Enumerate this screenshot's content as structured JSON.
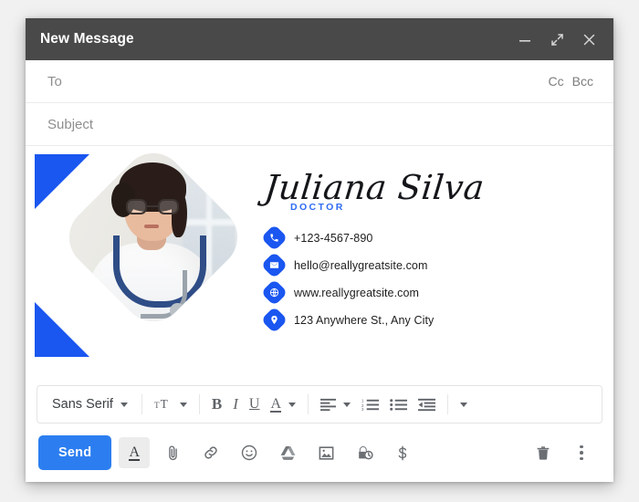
{
  "window": {
    "title": "New Message",
    "controls": [
      {
        "name": "minimize",
        "glyph": "minimize-icon"
      },
      {
        "name": "expand",
        "glyph": "expand-icon"
      },
      {
        "name": "close",
        "glyph": "close-icon"
      }
    ]
  },
  "fields": {
    "to_label": "To",
    "cc_label": "Cc",
    "bcc_label": "Bcc",
    "subject_label": "Subject",
    "to_value": "",
    "subject_value": ""
  },
  "signature": {
    "name": "Juliana Silva",
    "role": "DOCTOR",
    "accent_color": "#1a56f0",
    "role_color": "#2f6bf2",
    "contacts": [
      {
        "icon": "phone-icon",
        "text": "+123-4567-890"
      },
      {
        "icon": "envelope-icon",
        "text": "hello@reallygreatsite.com"
      },
      {
        "icon": "globe-icon",
        "text": "www.reallygreatsite.com"
      },
      {
        "icon": "location-pin-icon",
        "text": "123 Anywhere St., Any City"
      }
    ],
    "photo_alt": "doctor-portrait"
  },
  "format_toolbar": {
    "font_name": "Sans Serif",
    "items": [
      {
        "name": "font-size",
        "label": "TT"
      },
      {
        "name": "bold",
        "label": "B"
      },
      {
        "name": "italic",
        "label": "I"
      },
      {
        "name": "underline",
        "label": "U"
      },
      {
        "name": "text-color",
        "label": "A"
      },
      {
        "name": "align",
        "label": "align"
      },
      {
        "name": "numbered-list",
        "label": "1."
      },
      {
        "name": "bulleted-list",
        "label": "•"
      },
      {
        "name": "indent-less",
        "label": "indent"
      },
      {
        "name": "more-format",
        "label": "more"
      }
    ]
  },
  "action_bar": {
    "send_label": "Send",
    "send_color": "#2c7ef0",
    "icons": [
      {
        "name": "formatting-options-icon",
        "label": "A"
      },
      {
        "name": "attach-file-icon",
        "label": "attach"
      },
      {
        "name": "insert-link-icon",
        "label": "link"
      },
      {
        "name": "insert-emoji-icon",
        "label": "emoji"
      },
      {
        "name": "insert-drive-icon",
        "label": "drive"
      },
      {
        "name": "insert-photo-icon",
        "label": "photo"
      },
      {
        "name": "confidential-mode-icon",
        "label": "confidential"
      },
      {
        "name": "insert-money-icon",
        "label": "$"
      },
      {
        "name": "discard-draft-icon",
        "label": "trash"
      },
      {
        "name": "more-options-icon",
        "label": "more"
      }
    ]
  }
}
